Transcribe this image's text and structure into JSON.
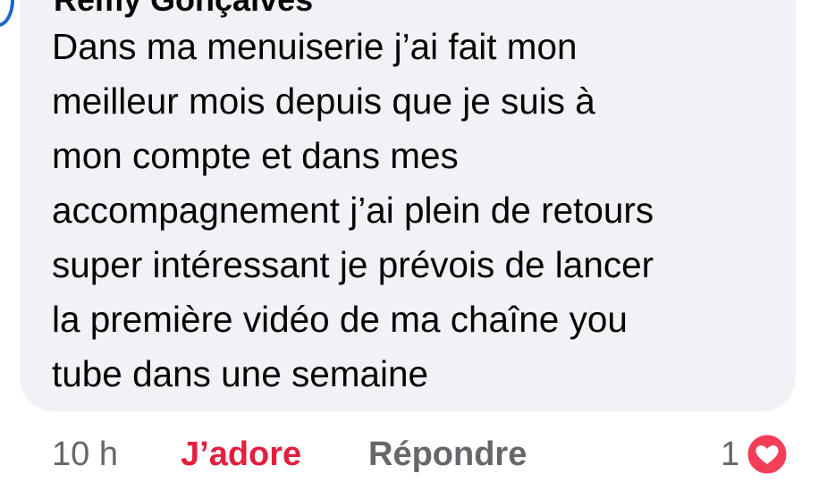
{
  "comment": {
    "author": "Rémy Gonçalves",
    "text_lines": [
      "Dans ma menuiserie j’ai fait mon",
      "meilleur mois depuis que je suis à",
      "mon compte et dans mes",
      "accompagnement j’ai plein de retours",
      "super intéressant je prévois de lancer",
      "la première vidéo de ma chaîne you",
      "tube dans une semaine"
    ]
  },
  "actions": {
    "time": "10 h",
    "like_label": "J’adore",
    "reply_label": "Répondre",
    "reaction_count": "1",
    "reaction_icon": "heart-icon"
  },
  "colors": {
    "bubble": "#f0f2f5",
    "like_active": "#e41e3f",
    "secondary_text": "#65676b",
    "heart_bg": "#f33e58"
  }
}
